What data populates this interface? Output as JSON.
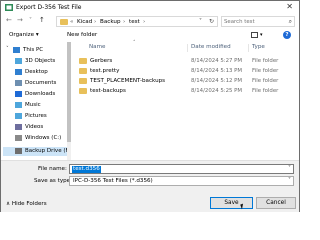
{
  "window": {
    "title": "Export D-356 Test File",
    "close_glyph": "✕"
  },
  "nav_buttons": {
    "back": "←",
    "forward": "→",
    "recent": "˅",
    "up": "↑"
  },
  "address": {
    "crumbs": [
      "Kicad",
      "Backup",
      "test"
    ],
    "separator": "›",
    "leading_sep": "«",
    "dropdown": "˅",
    "refresh": "↻"
  },
  "search": {
    "placeholder": "Search test",
    "icon": "⌕"
  },
  "toolbar": {
    "organize_label": "Organize ▾",
    "new_folder_label": "New folder",
    "help_label": "?"
  },
  "nav_pane": {
    "items": [
      {
        "label": "This PC",
        "icon": "computer-icon",
        "color": "#2f7fd0",
        "chevron": "˅",
        "selected": false
      },
      {
        "label": "3D Objects",
        "icon": "cube-icon",
        "color": "#4ea6dc",
        "chevron": "›",
        "selected": false
      },
      {
        "label": "Desktop",
        "icon": "desktop-icon",
        "color": "#2f7fd0",
        "chevron": "›",
        "selected": false
      },
      {
        "label": "Documents",
        "icon": "documents-icon",
        "color": "#6e8fb0",
        "chevron": "›",
        "selected": false
      },
      {
        "label": "Downloads",
        "icon": "download-icon",
        "color": "#1e6ad6",
        "chevron": "›",
        "selected": false
      },
      {
        "label": "Music",
        "icon": "music-icon",
        "color": "#4ea6dc",
        "chevron": "›",
        "selected": false
      },
      {
        "label": "Pictures",
        "icon": "pictures-icon",
        "color": "#4ea6dc",
        "chevron": "›",
        "selected": false
      },
      {
        "label": "Videos",
        "icon": "videos-icon",
        "color": "#6e6e9e",
        "chevron": "›",
        "selected": false
      },
      {
        "label": "Windows (C:)",
        "icon": "drive-icon",
        "color": "#8a8a8a",
        "chevron": "›",
        "selected": false
      },
      {
        "label": "Backup Drive (F:",
        "icon": "drive-icon",
        "color": "#6d6d6d",
        "chevron": "›",
        "selected": true
      }
    ]
  },
  "file_list": {
    "columns": {
      "name": "Name",
      "date": "Date modified",
      "type": "Type",
      "sort_chevron": "˄"
    },
    "rows": [
      {
        "name": "Gerbers",
        "date": "8/14/2024 5:27 PM",
        "type": "File folder"
      },
      {
        "name": "test.pretty",
        "date": "8/14/2024 5:13 PM",
        "type": "File folder"
      },
      {
        "name": "TEST_PLACEMENT-backups",
        "date": "8/14/2024 5:12 PM",
        "type": "File folder"
      },
      {
        "name": "test-backups",
        "date": "8/14/2024 5:25 PM",
        "type": "File folder"
      }
    ]
  },
  "form": {
    "file_name_label": "File name:",
    "file_name_value": "test.d356",
    "save_as_label": "Save as type:",
    "save_as_value": "IPC-D-356 Test Files (*.d356)",
    "dropdown_glyph": "˅"
  },
  "footer": {
    "hide_folders_label": "∧  Hide Folders",
    "save_label": "Save",
    "cancel_label": "Cancel"
  },
  "colors": {
    "accent": "#0078d7",
    "selection_bg": "#cce4f7",
    "folder": "#e8c05a",
    "dialog_bg": "#f0f0f0"
  }
}
